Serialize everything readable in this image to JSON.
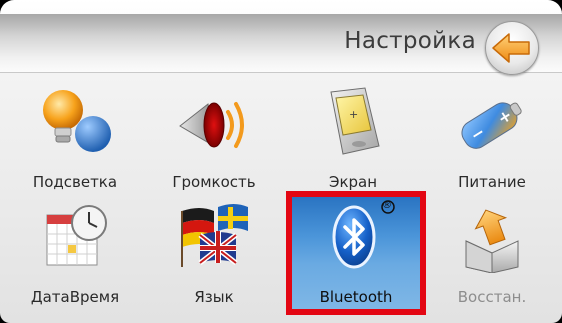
{
  "header": {
    "title": "Настройка"
  },
  "tiles": [
    {
      "label": "Подсветка"
    },
    {
      "label": "Громкость"
    },
    {
      "label": "Экран"
    },
    {
      "label": "Питание"
    },
    {
      "label": "ДатаВремя"
    },
    {
      "label": "Язык"
    },
    {
      "label": "Bluetooth",
      "selected": true,
      "badge": "®"
    },
    {
      "label": "Восстан.",
      "disabled": true
    }
  ],
  "colors": {
    "selection_border": "#e30613",
    "selected_background": "#4b95d9",
    "back_arrow": "#f4a31e"
  },
  "icons": {
    "back": "back-arrow-icon",
    "backlight": "lightbulb-icon",
    "volume": "speaker-icon",
    "screen": "pda-screen-icon",
    "power": "battery-icon",
    "datetime": "calendar-clock-icon",
    "language": "flags-icon",
    "bluetooth": "bluetooth-icon",
    "restore": "box-restore-icon"
  }
}
